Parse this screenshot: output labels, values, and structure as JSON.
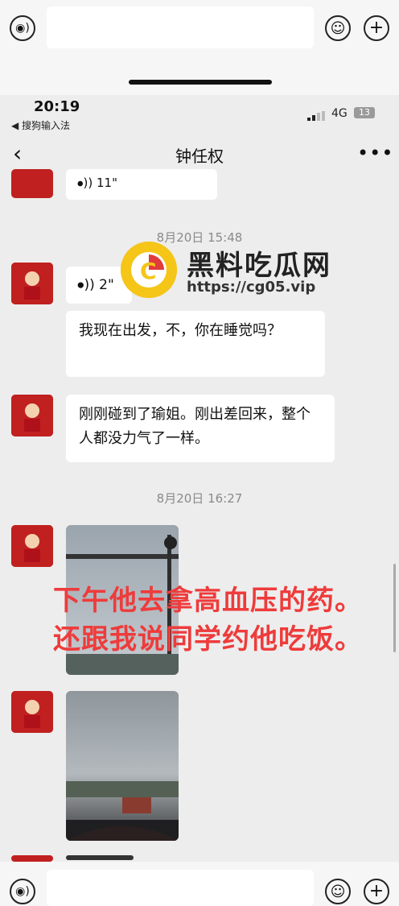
{
  "app": {
    "status_time": "20:19",
    "back_to_app": "◀ 搜狗输入法",
    "network": "4G",
    "battery": "13"
  },
  "header": {
    "contact_name": "钟任权"
  },
  "watermark": {
    "title": "黑料吃瓜网",
    "url": "https://cg05.vip"
  },
  "messages": {
    "first_voice": "11\"",
    "ts1": "8月20日 15:48",
    "voice2": "2\"",
    "text1": "我现在出发，不，你在睡觉吗？",
    "text2": "刚刚碰到了瑜姐。刚出差回来，整个人都没力气了一样。",
    "ts2": "8月20日 16:27"
  },
  "overlay": {
    "line1": "下午他去拿高血压的药。",
    "line2": "还跟我说同学约他吃饭。"
  },
  "icons": {
    "voice": "voice-icon",
    "emoji": "emoji-icon",
    "plus": "plus-icon",
    "back": "back-icon",
    "more": "more-icon"
  },
  "colors": {
    "overlay_red": "#ee3b3b",
    "avatar_red": "#c0201f",
    "watermark_yellow": "#f5c518"
  }
}
